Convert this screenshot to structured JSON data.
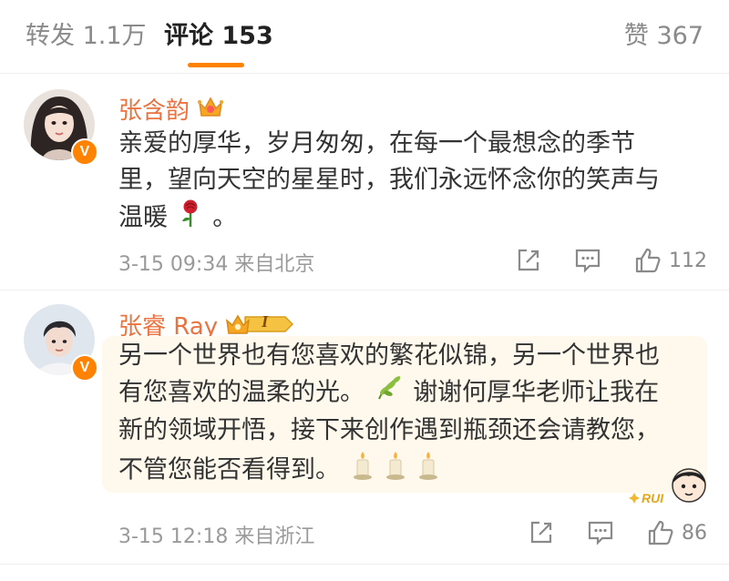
{
  "tabs": {
    "repost": "转发 1.1万",
    "comments": "评论 153",
    "likes": "赞 367"
  },
  "comments": [
    {
      "username": "张含韵",
      "text_a": "亲爱的厚华，岁月匆匆，在每一个最想念的季节里，望向天空的星星时，我们永远怀念你的笑声与温暖",
      "text_b": "。",
      "meta": "3-15 09:34 来自北京",
      "likes": "112",
      "icons": [
        "crown-icon",
        "rose-icon"
      ]
    },
    {
      "username": "张睿 Ray",
      "text_a": "另一个世界也有您喜欢的繁花似锦，另一个世界也有您喜欢的温柔的光。",
      "text_b": "谢谢何厚华老师让我在新的领域开悟，接下来创作遇到瓶颈还会请教您，不管您能否看得到。",
      "meta": "3-15 12:18 来自浙江",
      "likes": "86",
      "level_badge": "I",
      "sticker_text": "RUI",
      "icons": [
        "crown-level-icon",
        "leaf-icon",
        "candle-icon"
      ]
    }
  ],
  "colors": {
    "accent": "#ff8200",
    "username": "#eb7340",
    "text": "#333333",
    "meta": "#9a9a9a",
    "bubble": "#fff8ec"
  }
}
